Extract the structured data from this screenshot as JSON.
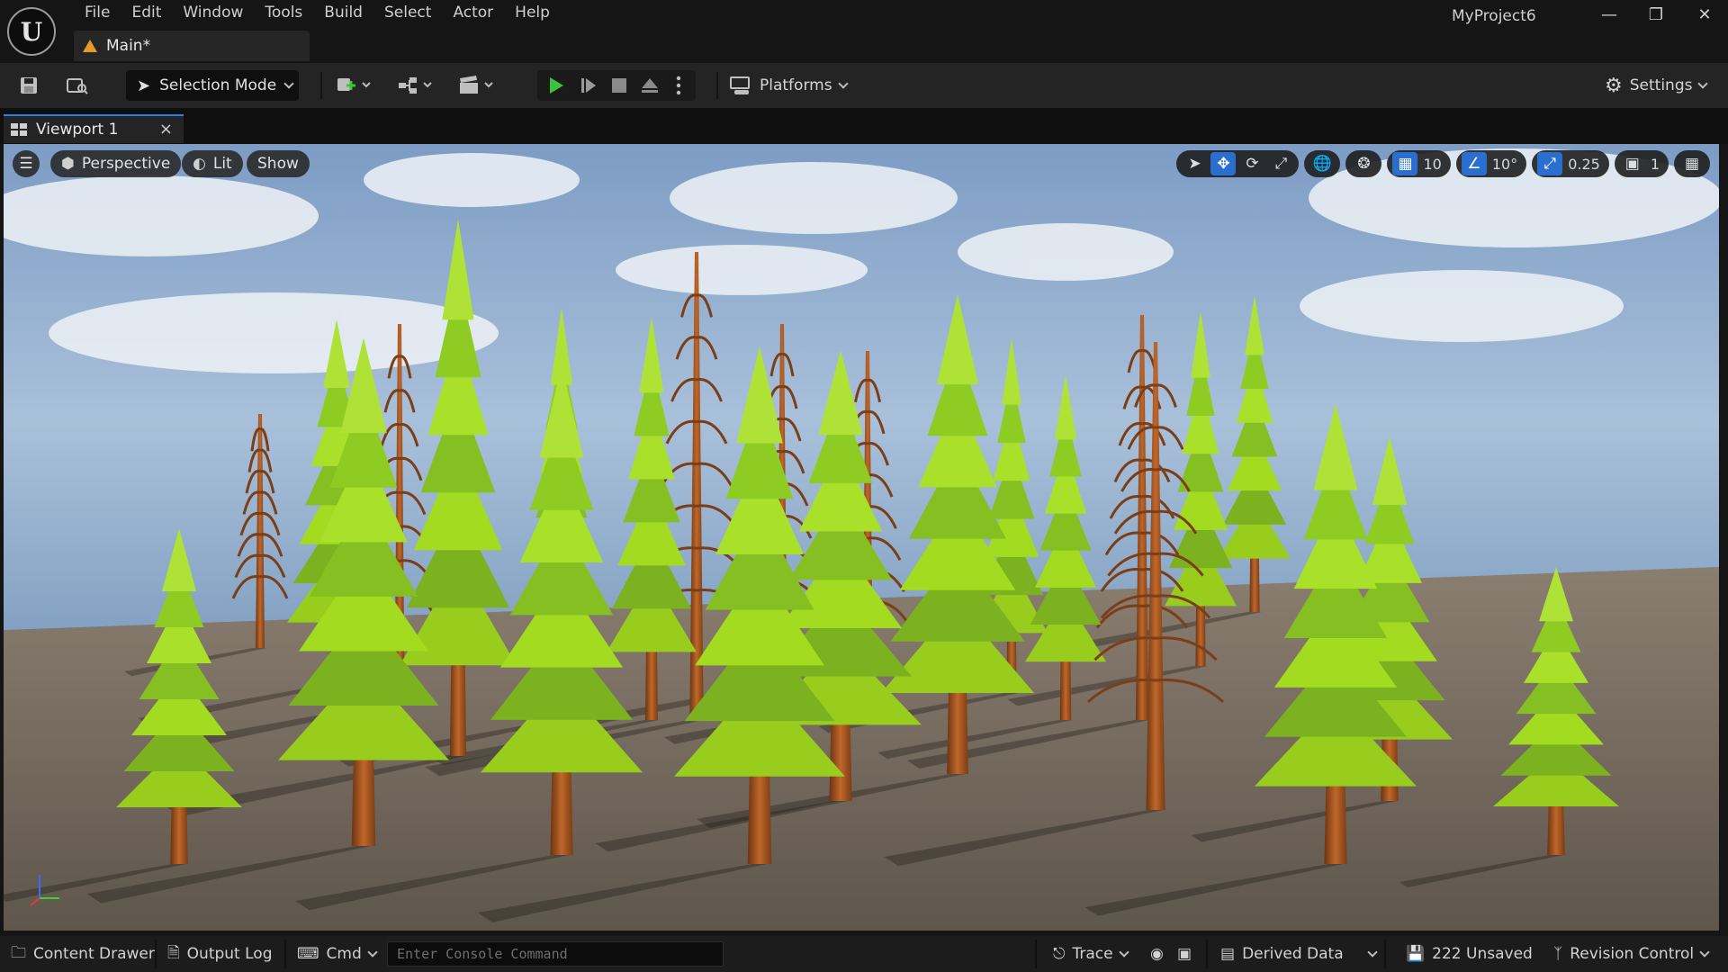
{
  "app": {
    "project_name": "MyProject6",
    "logo_letter": "U",
    "document_tab": "Main*"
  },
  "menu": [
    "File",
    "Edit",
    "Window",
    "Tools",
    "Build",
    "Select",
    "Actor",
    "Help"
  ],
  "toolbar": {
    "selection_mode": "Selection Mode",
    "platforms": "Platforms",
    "settings": "Settings"
  },
  "viewport_tab": {
    "label": "Viewport 1",
    "close": "×"
  },
  "viewport": {
    "perspective": "Perspective",
    "lit": "Lit",
    "show": "Show",
    "grid_snap": "10",
    "rotation_snap": "10°",
    "scale_snap": "0.25",
    "camera_speed": "1"
  },
  "statusbar": {
    "content_drawer": "Content Drawer",
    "output_log": "Output Log",
    "cmd": "Cmd",
    "console_placeholder": "Enter Console Command",
    "trace": "Trace",
    "derived_data": "Derived Data",
    "unsaved": "222 Unsaved",
    "revision_control": "Revision Control"
  },
  "colors": {
    "accent": "#2a6fcf",
    "play_green": "#3cc33c",
    "sky_top": "#6f8fb5",
    "ground": "#6b5f52",
    "foliage": "#8fcf2a",
    "trunk": "#a3521d"
  }
}
